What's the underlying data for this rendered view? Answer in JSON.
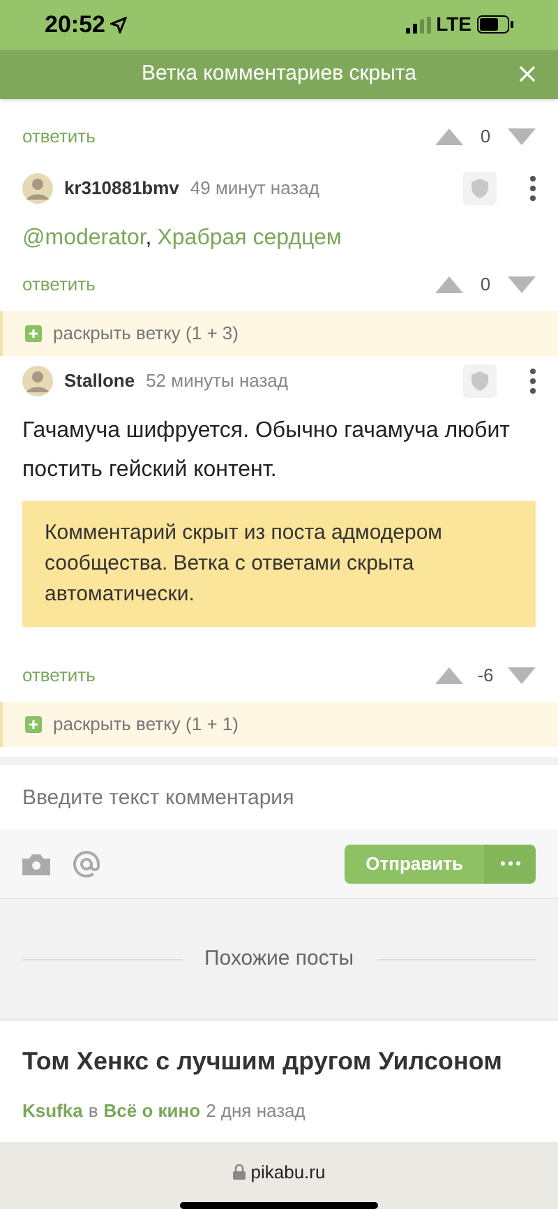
{
  "status_bar": {
    "time": "20:52",
    "network": "LTE"
  },
  "banner": {
    "text": "Ветка комментариев скрыта"
  },
  "top_actions": {
    "reply": "ответить",
    "rating": "0"
  },
  "comments": [
    {
      "author": "kr310881bmv",
      "time": "49 минут назад",
      "body": [
        {
          "kind": "link",
          "text": "@moderator"
        },
        {
          "kind": "plain",
          "text": ","
        },
        {
          "kind": "link",
          "text": "Храбрая сердцем"
        }
      ],
      "reply": "ответить",
      "rating": "0",
      "expand": "раскрыть ветку (1 + 3)"
    },
    {
      "author": "Stallone",
      "time": "52 минуты назад",
      "body": [
        {
          "kind": "plain",
          "text": "Гачамуча шифруется. Обычно гачамуча любит постить гейский контент."
        }
      ],
      "notice": "Комментарий скрыт из поста адмодером сообщества. Ветка с ответами скрыта автоматически.",
      "reply": "ответить",
      "rating": "-6",
      "expand": "раскрыть ветку (1 + 1)"
    }
  ],
  "comment_form": {
    "placeholder": "Введите текст комментария",
    "send": "Отправить"
  },
  "similar": {
    "heading": "Похожие посты",
    "post": {
      "title": "Том Хенкс с лучшим другом Уилсоном",
      "author": "Ksufka",
      "in": "в",
      "community": "Всё о кино",
      "time": "2 дня назад"
    }
  },
  "browser": {
    "url": "pikabu.ru"
  }
}
